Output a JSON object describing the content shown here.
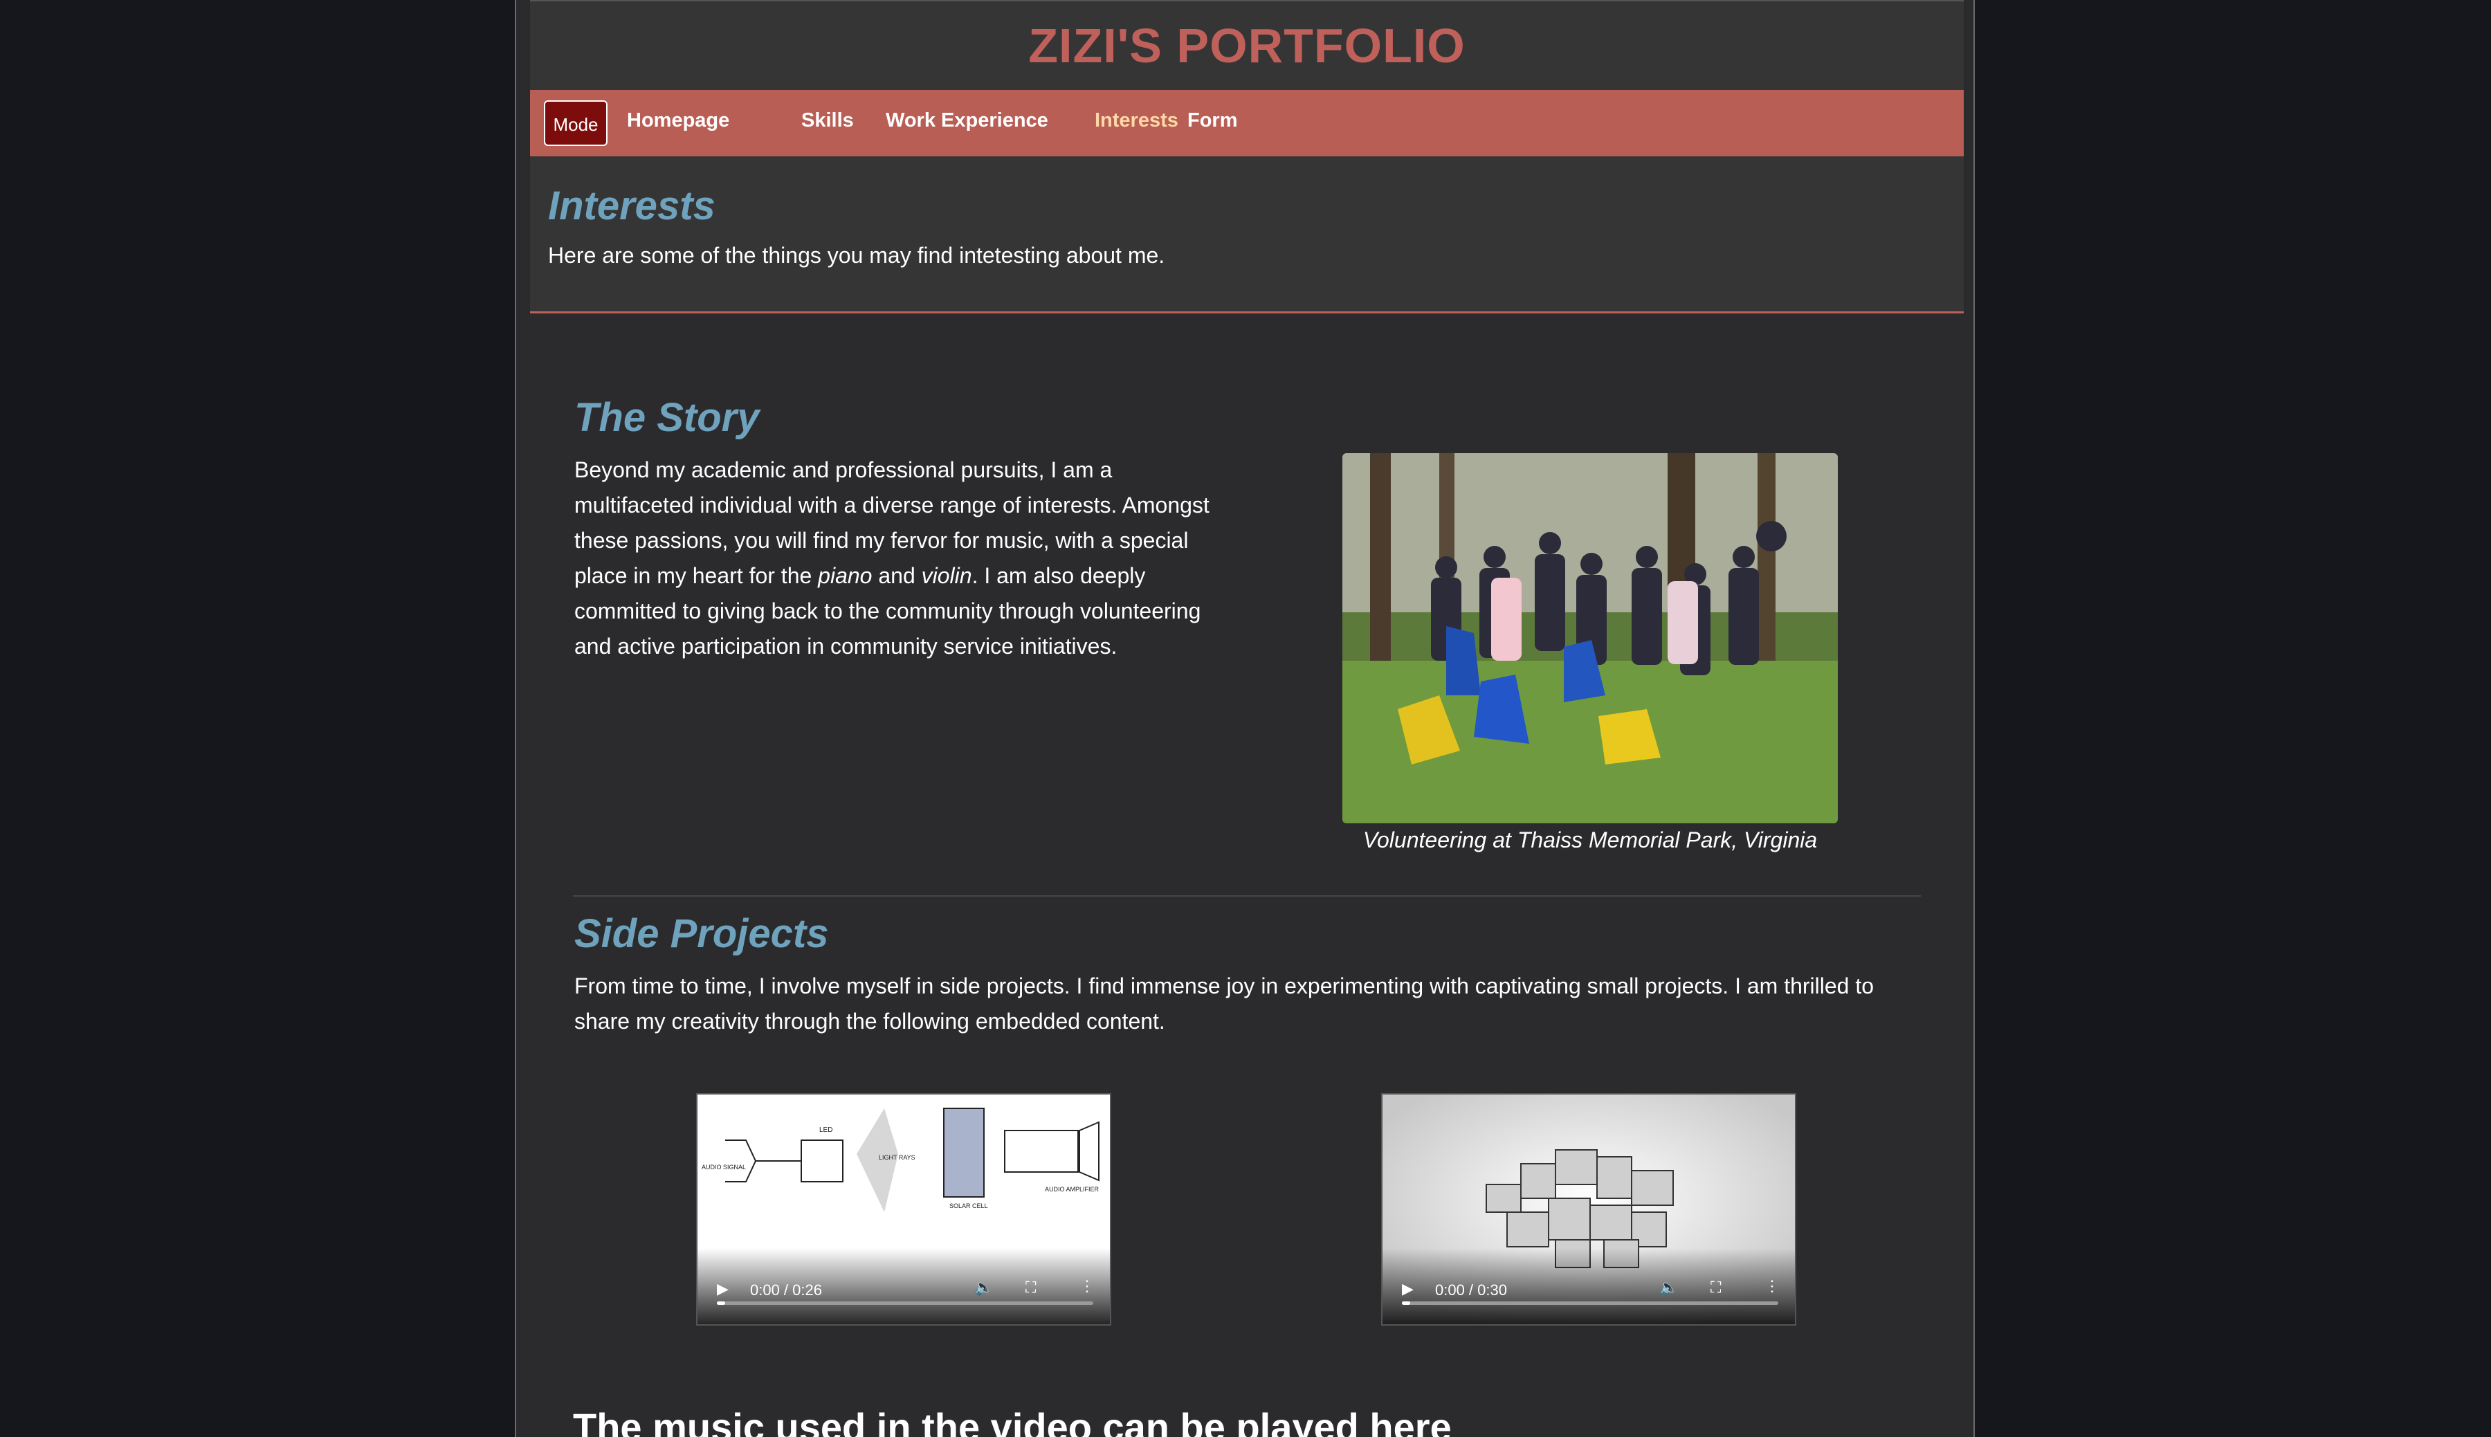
{
  "site": {
    "title": "ZIZI'S PORTFOLIO"
  },
  "nav": {
    "mode_label": "Mode",
    "links": [
      "Homepage",
      "Skills",
      "Work Experience",
      "Interests",
      "Form"
    ],
    "active": "Interests"
  },
  "header": {
    "title": "Interests",
    "intro": "Here are some of the things you may find intetesting about me."
  },
  "story": {
    "title": "The Story",
    "text_1": "Beyond my academic and professional pursuits, I am a multifaceted individual with a diverse range of interests. Amongst these passions, you will find my fervor for music, with a special place in my heart for the ",
    "em_1": "piano",
    "text_2": " and ",
    "em_2": "violin",
    "text_3": ". I am also deeply committed to giving back to the community through volunteering and active participation in community service initiatives.",
    "photo_caption": "Volunteering at Thaiss Memorial Park, Virginia"
  },
  "side_projects": {
    "title": "Side Projects",
    "text": "From time to time, I involve myself in side projects. I find immense joy in experimenting with captivating small projects. I am thrilled to share my creativity through the following embedded content.",
    "videos": [
      {
        "time": "0:00 / 0:26",
        "diagram_labels": [
          "LED",
          "AUDIO SIGNAL",
          "LIGHT RAYS",
          "SOLAR CELL",
          "AUDIO AMPLIFIER"
        ]
      },
      {
        "time": "0:00 / 0:30"
      }
    ]
  },
  "music": {
    "heading": "The music used in the video can be played here"
  },
  "colors": {
    "accent": "#c0605a",
    "nav": "#b85e55",
    "heading": "#6fa3bd",
    "mode_button": "#7d0c0c"
  }
}
